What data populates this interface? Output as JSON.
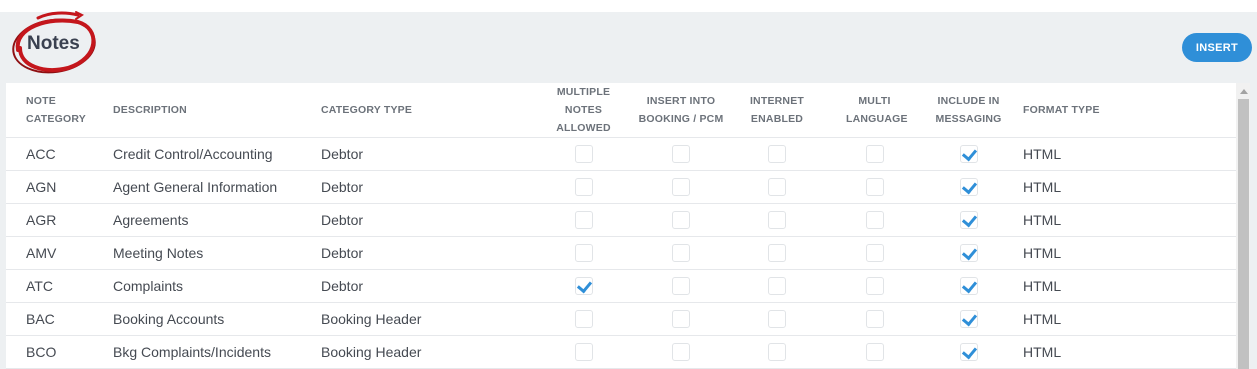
{
  "page": {
    "title": "Notes"
  },
  "toolbar": {
    "insert_label": "INSERT"
  },
  "colors": {
    "accent": "#2f8fd8",
    "annotation": "#c4161c"
  },
  "table": {
    "headers": {
      "note_category": "NOTE CATEGORY",
      "description": "DESCRIPTION",
      "category_type": "CATEGORY TYPE",
      "multiple_notes": "MULTIPLE NOTES ALLOWED",
      "insert_into_booking": "INSERT INTO BOOKING / PCM",
      "internet_enabled": "INTERNET ENABLED",
      "multi_language": "MULTI LANGUAGE",
      "include_in_messaging": "INCLUDE IN MESSAGING",
      "format_type": "FORMAT TYPE"
    },
    "rows": [
      {
        "code": "ACC",
        "description": "Credit Control/Accounting",
        "category_type": "Debtor",
        "multiple_notes": false,
        "insert_booking": false,
        "internet_enabled": false,
        "multi_language": false,
        "include_messaging": true,
        "format_type": "HTML"
      },
      {
        "code": "AGN",
        "description": "Agent General Information",
        "category_type": "Debtor",
        "multiple_notes": false,
        "insert_booking": false,
        "internet_enabled": false,
        "multi_language": false,
        "include_messaging": true,
        "format_type": "HTML"
      },
      {
        "code": "AGR",
        "description": "Agreements",
        "category_type": "Debtor",
        "multiple_notes": false,
        "insert_booking": false,
        "internet_enabled": false,
        "multi_language": false,
        "include_messaging": true,
        "format_type": "HTML"
      },
      {
        "code": "AMV",
        "description": "Meeting Notes",
        "category_type": "Debtor",
        "multiple_notes": false,
        "insert_booking": false,
        "internet_enabled": false,
        "multi_language": false,
        "include_messaging": true,
        "format_type": "HTML"
      },
      {
        "code": "ATC",
        "description": "Complaints",
        "category_type": "Debtor",
        "multiple_notes": true,
        "insert_booking": false,
        "internet_enabled": false,
        "multi_language": false,
        "include_messaging": true,
        "format_type": "HTML"
      },
      {
        "code": "BAC",
        "description": "Booking Accounts",
        "category_type": "Booking Header",
        "multiple_notes": false,
        "insert_booking": false,
        "internet_enabled": false,
        "multi_language": false,
        "include_messaging": true,
        "format_type": "HTML"
      },
      {
        "code": "BCO",
        "description": "Bkg Complaints/Incidents",
        "category_type": "Booking Header",
        "multiple_notes": false,
        "insert_booking": false,
        "internet_enabled": false,
        "multi_language": false,
        "include_messaging": true,
        "format_type": "HTML"
      }
    ]
  }
}
